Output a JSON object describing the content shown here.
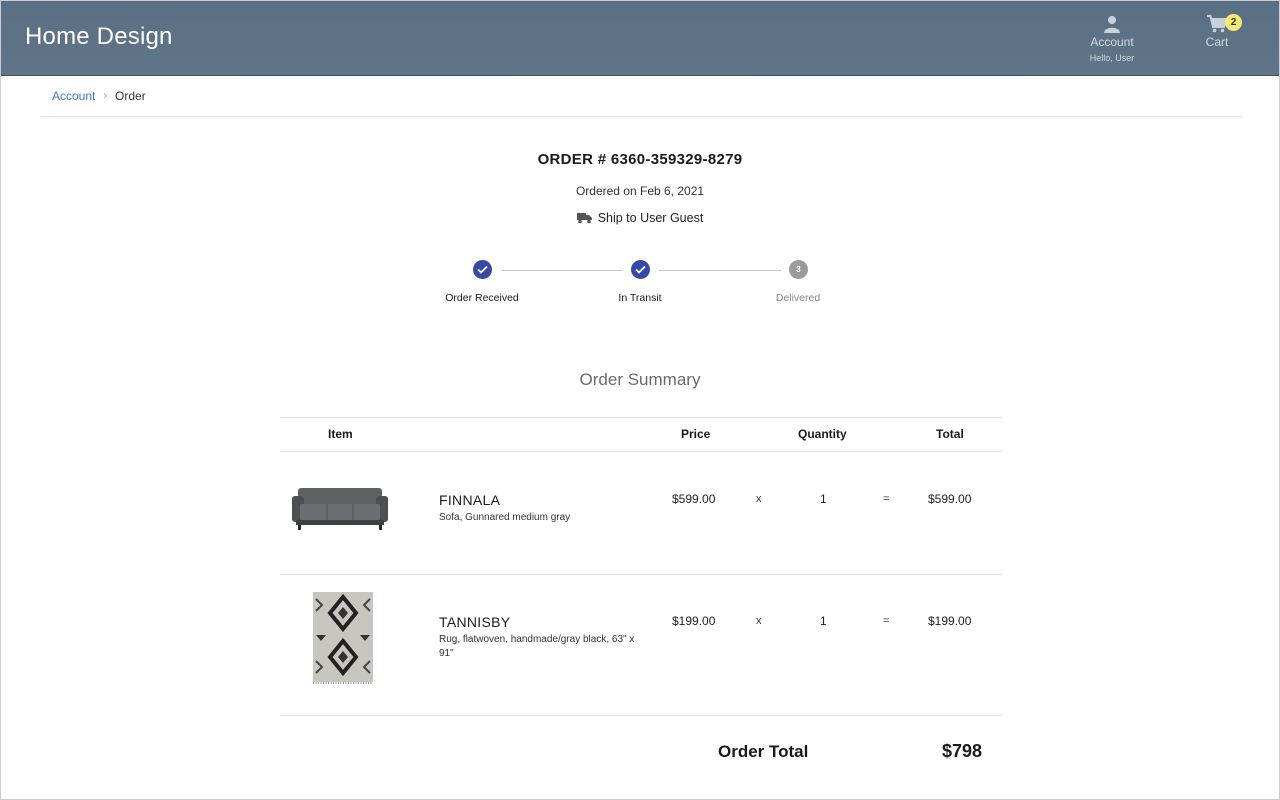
{
  "header": {
    "brand": "Home Design",
    "account_label": "Account",
    "account_greeting": "Hello, User",
    "cart_label": "Cart",
    "cart_count": "2"
  },
  "breadcrumb": {
    "items": [
      "Account",
      "Order"
    ],
    "separator": "›"
  },
  "order": {
    "title": "ORDER # 6360-359329-8279",
    "date": "Ordered on Feb 6, 2021",
    "ship_to": "Ship to User Guest"
  },
  "progress": {
    "steps": [
      {
        "label": "Order Received",
        "status": "complete",
        "icon": "check-icon"
      },
      {
        "label": "In Transit",
        "status": "complete",
        "icon": "check-icon"
      },
      {
        "label": "Delivered",
        "status": "pending",
        "number": "3"
      }
    ]
  },
  "summary": {
    "title": "Order Summary",
    "columns": [
      "Item",
      "Price",
      "Quantity",
      "Total"
    ],
    "items": [
      {
        "name": "FINNALA",
        "description": "Sofa, Gunnared medium gray",
        "price": "$599.00",
        "multiply": "x",
        "quantity": "1",
        "equals": "=",
        "total": "$599.00",
        "image": "gray-sofa"
      },
      {
        "name": "TANNISBY",
        "description": "Rug, flatwoven, handmade/gray black, 63\" x 91\"",
        "price": "$199.00",
        "multiply": "x",
        "quantity": "1",
        "equals": "=",
        "total": "$199.00",
        "image": "patterned-rug"
      }
    ],
    "order_total_label": "Order Total",
    "order_total_value": "$798"
  },
  "colors": {
    "header_bg": "#5e7386",
    "step_complete": "#3848a6",
    "step_pending": "#9b9b9b",
    "link": "#3b78c8",
    "badge": "#f6ea72"
  }
}
